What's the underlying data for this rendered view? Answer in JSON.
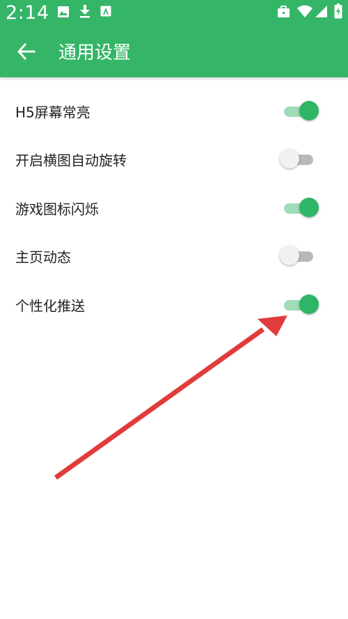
{
  "status_bar": {
    "time": "2:14",
    "left_icons": [
      "image-icon",
      "download-icon",
      "store-icon"
    ],
    "right_icons": [
      "briefcase-icon",
      "wifi-icon",
      "signal-icon",
      "battery-charging-icon"
    ]
  },
  "toolbar": {
    "title": "通用设置",
    "back_icon": "arrow-back-icon"
  },
  "settings": [
    {
      "label": "H5屏幕常亮",
      "enabled": true
    },
    {
      "label": "开启横图自动旋转",
      "enabled": false
    },
    {
      "label": "游戏图标闪烁",
      "enabled": true
    },
    {
      "label": "主页动态",
      "enabled": false
    },
    {
      "label": "个性化推送",
      "enabled": true
    }
  ],
  "colors": {
    "accent": "#34b567",
    "switch_on_thumb": "#2eb565",
    "switch_on_track": "#9fdcb7",
    "switch_off_thumb": "#f1f1f1",
    "switch_off_track": "#b9b9b9",
    "annotation_arrow": "#e03c3c"
  }
}
